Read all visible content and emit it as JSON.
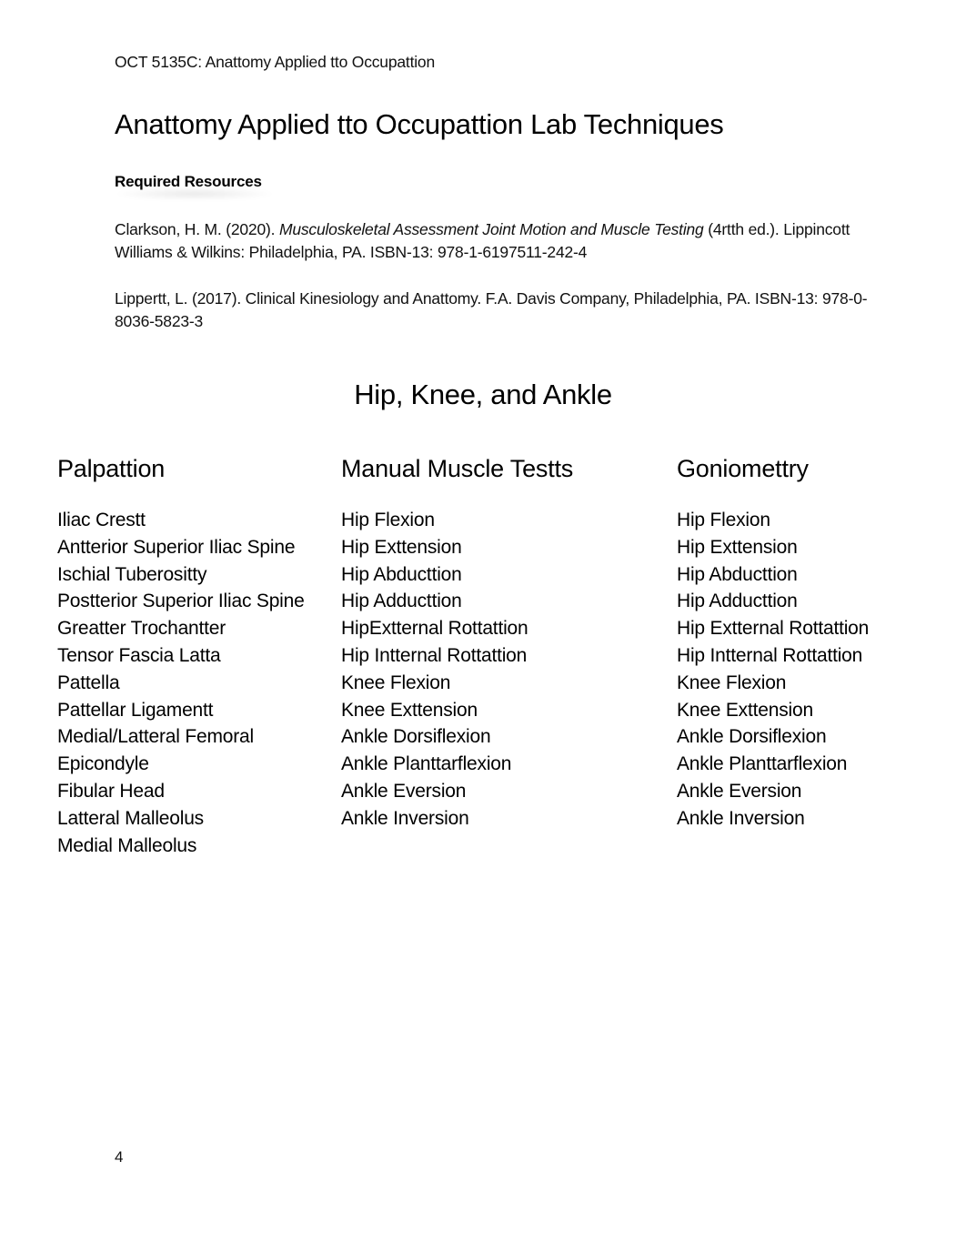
{
  "header": {
    "course": "OCT 5135C: Anattomy Applied tto Occupattion"
  },
  "title": "Anattomy Applied tto Occupattion Lab Techniques",
  "resources": {
    "heading": "Required Resources",
    "references": [
      {
        "prefix": "Clarkson, H. M. (2020). ",
        "italic": "Musculoskeletal Assessment Joint Motion and Muscle Testing",
        "suffix": " (4rtth ed.). Lippincott Williams & Wilkins: Philadelphia, PA. ISBN-13: 978-1-6197511-242-4"
      },
      {
        "prefix": "Lippertt, L. (2017). Clinical Kinesiology and Anattomy. F.A. Davis Company, Philadelphia, PA. ISBN-13: 978-0-8036-5823-3",
        "italic": "",
        "suffix": ""
      }
    ]
  },
  "section": {
    "title": "Hip, Knee, and Ankle",
    "columns": [
      {
        "title": "Palpattion",
        "items": [
          "Iliac Crestt",
          "Antterior Superior Iliac Spine",
          "Ischial Tuberositty",
          "Postterior Superior Iliac Spine",
          "Greatter Trochantter",
          "Tensor Fascia Latta",
          "Pattella",
          "Pattellar Ligamentt",
          "Medial/Latteral Femoral",
          "Epicondyle",
          "Fibular Head",
          "Latteral Malleolus",
          "Medial Malleolus"
        ]
      },
      {
        "title": "Manual Muscle Testts",
        "items": [
          "Hip Flexion",
          "Hip Exttension",
          "Hip Abducttion",
          "Hip Adducttion",
          "HipExtternal Rottattion",
          "Hip Intternal Rottattion",
          "Knee Flexion",
          "Knee Exttension",
          "Ankle Dorsiflexion",
          "Ankle Planttarflexion",
          "Ankle Eversion",
          "Ankle Inversion"
        ]
      },
      {
        "title": "Goniomettry",
        "items": [
          "Hip Flexion",
          "Hip Exttension",
          "Hip Abducttion",
          "Hip Adducttion",
          "Hip Extternal Rottattion",
          "Hip Intternal Rottattion",
          "Knee Flexion",
          "Knee Exttension",
          "Ankle Dorsiflexion",
          "Ankle Planttarflexion",
          "Ankle Eversion",
          "Ankle Inversion"
        ]
      }
    ]
  },
  "footer": {
    "page_number": "4"
  }
}
